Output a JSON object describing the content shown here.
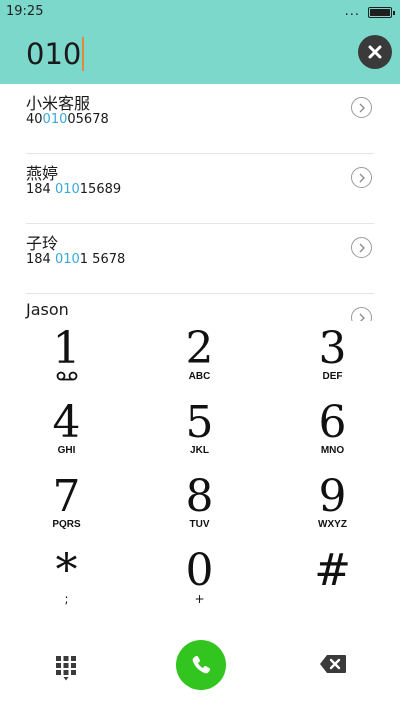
{
  "status_bar": {
    "time": "19:25",
    "dots": "..."
  },
  "dialer": {
    "number": "010"
  },
  "contacts": [
    {
      "name": "小米客服",
      "number_pre": "40",
      "number_hl": "010",
      "number_post": "05678"
    },
    {
      "name": "燕婷",
      "number_pre": "184 ",
      "number_hl": "010",
      "number_post": "15689"
    },
    {
      "name": "子玲",
      "number_pre": "184 ",
      "number_hl": "010",
      "number_post": "1 5678"
    },
    {
      "name": "Jason",
      "number_pre": "",
      "number_hl": "",
      "number_post": ""
    }
  ],
  "keypad": {
    "k1": {
      "digit": "1",
      "sub": "voicemail-icon"
    },
    "k2": {
      "digit": "2",
      "letters": "ABC"
    },
    "k3": {
      "digit": "3",
      "letters": "DEF"
    },
    "k4": {
      "digit": "4",
      "letters": "GHI"
    },
    "k5": {
      "digit": "5",
      "letters": "JKL"
    },
    "k6": {
      "digit": "6",
      "letters": "MNO"
    },
    "k7": {
      "digit": "7",
      "letters": "PQRS"
    },
    "k8": {
      "digit": "8",
      "letters": "TUV"
    },
    "k9": {
      "digit": "9",
      "letters": "WXYZ"
    },
    "kstar": {
      "digit": "*",
      "sub": ";"
    },
    "k0": {
      "digit": "0",
      "sub": "+"
    },
    "khash": {
      "digit": "#"
    }
  },
  "colors": {
    "header_bg": "#7dd8cc",
    "highlight": "#3aa8d8",
    "call_green": "#33c51f",
    "caret": "#e08a3c"
  },
  "icons": {
    "clear": "close-icon",
    "contact_detail": "chevron-right-icon",
    "dialpad_toggle": "grid-icon",
    "call": "phone-icon",
    "backspace": "backspace-icon"
  }
}
